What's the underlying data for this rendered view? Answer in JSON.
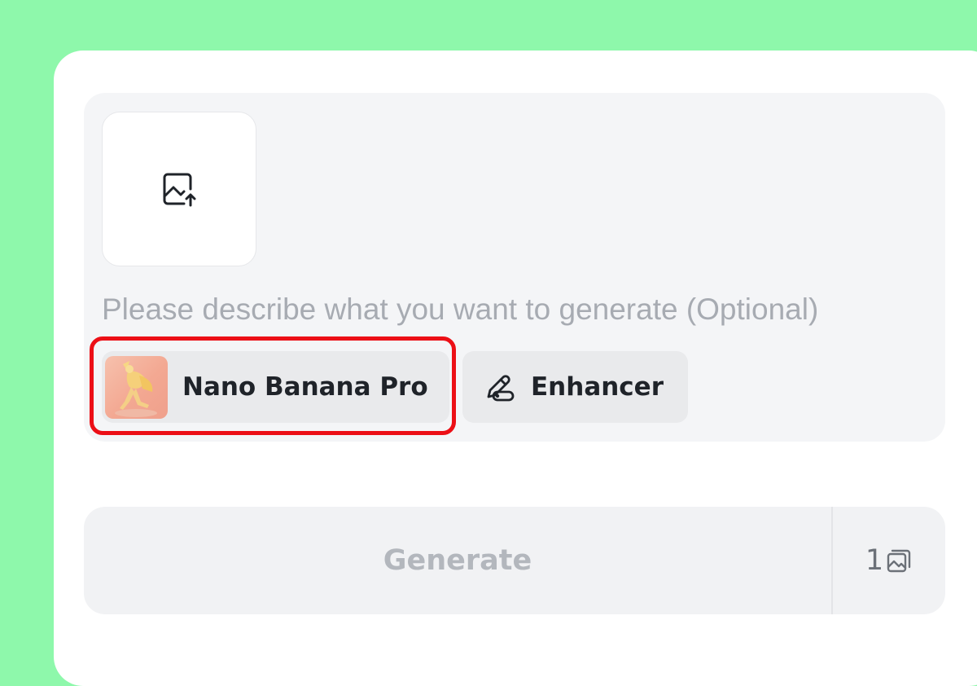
{
  "prompt": {
    "placeholder": "Please describe what you want to generate (Optional)",
    "value": ""
  },
  "upload": {
    "icon": "image-upload-icon"
  },
  "chips": {
    "model": {
      "label": "Nano Banana Pro",
      "icon": "model-thumbnail",
      "highlighted": true
    },
    "enhancer": {
      "label": "Enhancer",
      "icon": "enhancer-pen-icon"
    }
  },
  "generate": {
    "label": "Generate",
    "count": "1",
    "count_icon": "images-stack-icon"
  },
  "colors": {
    "background": "#8ef8ab",
    "card": "#ffffff",
    "panel": "#f4f5f7",
    "chip": "#e9eaec",
    "highlight": "#ec0f16",
    "generate_text_disabled": "#b3b7bd"
  }
}
